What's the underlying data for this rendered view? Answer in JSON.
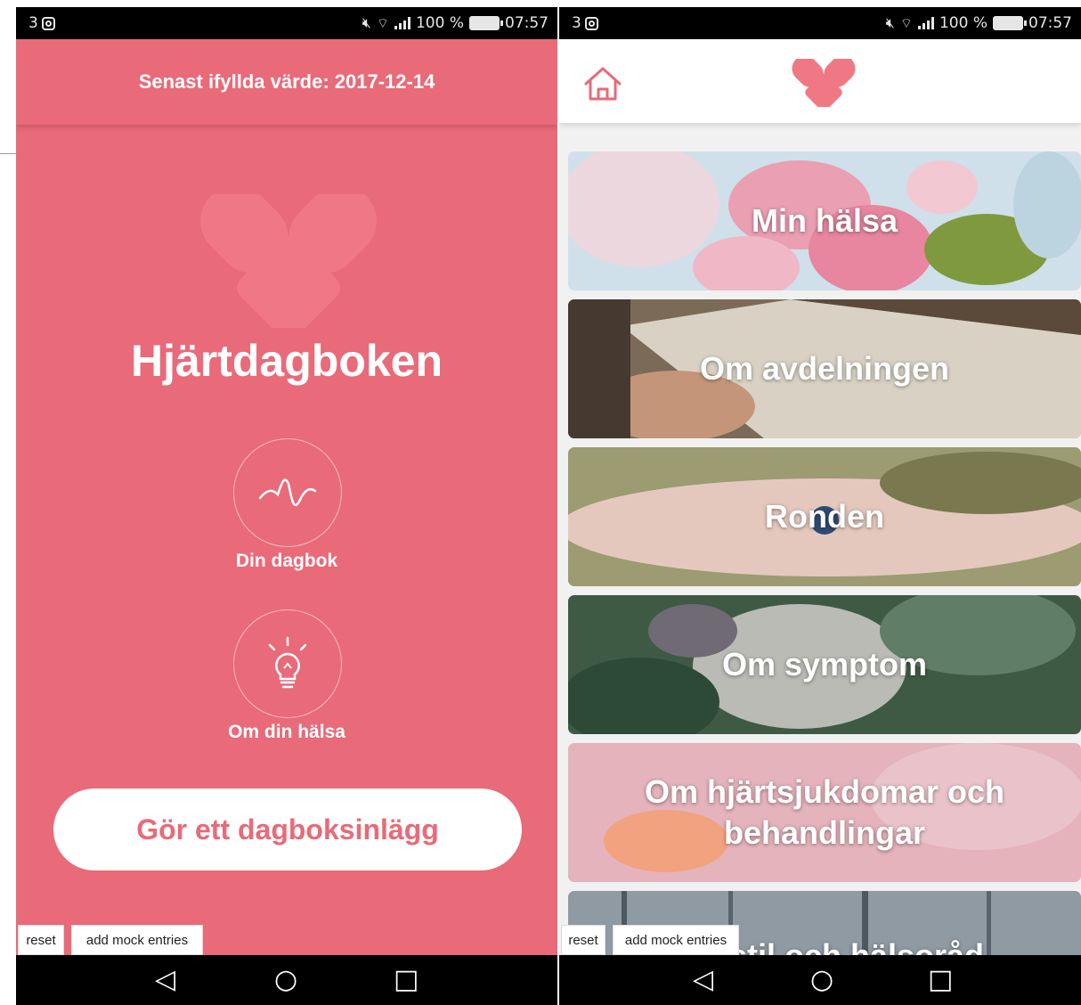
{
  "status_bar": {
    "carrier": "3",
    "battery": "100 %",
    "time": "07:57"
  },
  "left_screen": {
    "header_text": "Senast ifyllda värde: 2017-12-14",
    "app_title": "Hjärtdagboken",
    "diary_label": "Din dagbok",
    "health_label": "Om din hälsa",
    "cta_label": "Gör ett dagboksinlägg",
    "reset_label": "reset",
    "mock_label": "add mock entries"
  },
  "right_screen": {
    "cards": [
      {
        "title": "Min hälsa"
      },
      {
        "title": "Om avdelningen"
      },
      {
        "title": "Ronden"
      },
      {
        "title": "Om symptom"
      },
      {
        "title": "Om hjärtsjukdomar och behandlingar"
      },
      {
        "title": "Livsstil och hälsoråd"
      }
    ],
    "reset_label": "reset",
    "mock_label": "add mock entries"
  },
  "nav": {
    "back_icon": "◁",
    "home_icon": "○",
    "recents_icon": "□"
  },
  "colors": {
    "brand": "#e96a78",
    "logo": "#f07884"
  }
}
